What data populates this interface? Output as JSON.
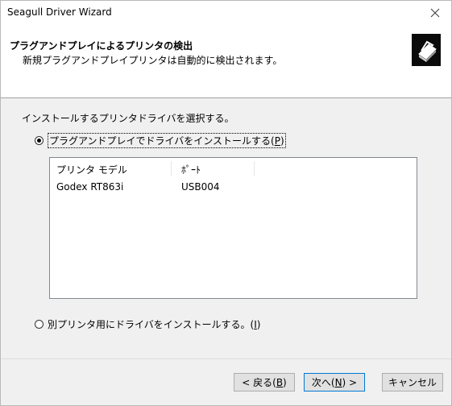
{
  "window": {
    "title": "Seagull Driver Wizard"
  },
  "header": {
    "title": "プラグアンドプレイによるプリンタの検出",
    "subtitle": "新規プラグアンドプレイプリンタは自動的に検出されます。"
  },
  "instruction": "インストールするプリンタドライバを選択する。",
  "options": {
    "pnp": {
      "label": "プラグアンドプレイでドライバをインストールする(",
      "mnemonic": "P",
      "suffix": ")",
      "selected": true
    },
    "other": {
      "label": "別プリンタ用にドライバをインストールする。(",
      "mnemonic": "I",
      "suffix": ")",
      "selected": false
    }
  },
  "printer_list": {
    "columns": [
      "プリンタ モデル",
      "ﾎﾟｰﾄ"
    ],
    "rows": [
      {
        "model": "Godex RT863i",
        "port": "USB004"
      }
    ]
  },
  "buttons": {
    "back": {
      "label": "< 戻る(",
      "mnemonic": "B",
      "suffix": ")"
    },
    "next": {
      "label": "次へ(",
      "mnemonic": "N",
      "suffix": ") >"
    },
    "cancel": {
      "label": "キャンセル"
    }
  }
}
